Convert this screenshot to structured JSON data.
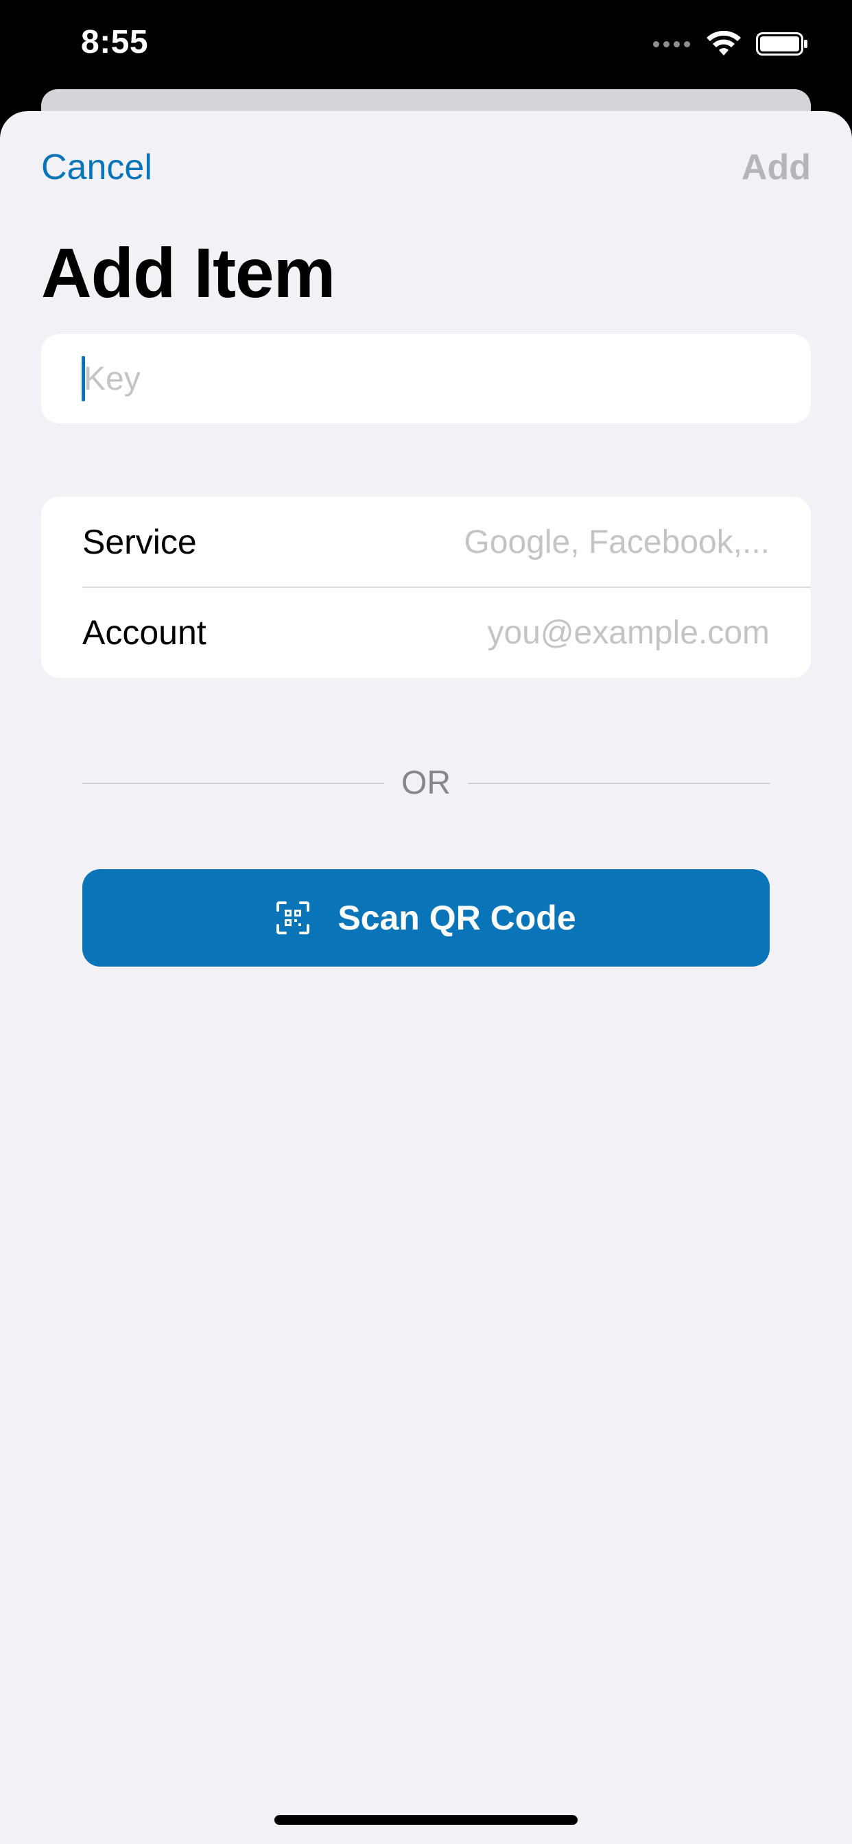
{
  "status_bar": {
    "time": "8:55",
    "icons": [
      "signal-icon",
      "wifi-icon",
      "battery-icon"
    ]
  },
  "nav": {
    "cancel_label": "Cancel",
    "add_label": "Add"
  },
  "page": {
    "title": "Add Item"
  },
  "key_field": {
    "placeholder": "Key",
    "value": ""
  },
  "details": {
    "service_label": "Service",
    "service_placeholder": "Google, Facebook,...",
    "account_label": "Account",
    "account_placeholder": "you@example.com"
  },
  "separator": {
    "text": "OR"
  },
  "scan_button": {
    "label": "Scan QR Code",
    "icon": "qr-code-scan-icon"
  },
  "colors": {
    "accent": "#0a74b8",
    "background": "#f1f1f6",
    "disabled": "#b4b4b9",
    "placeholder": "#c4c4c7"
  }
}
